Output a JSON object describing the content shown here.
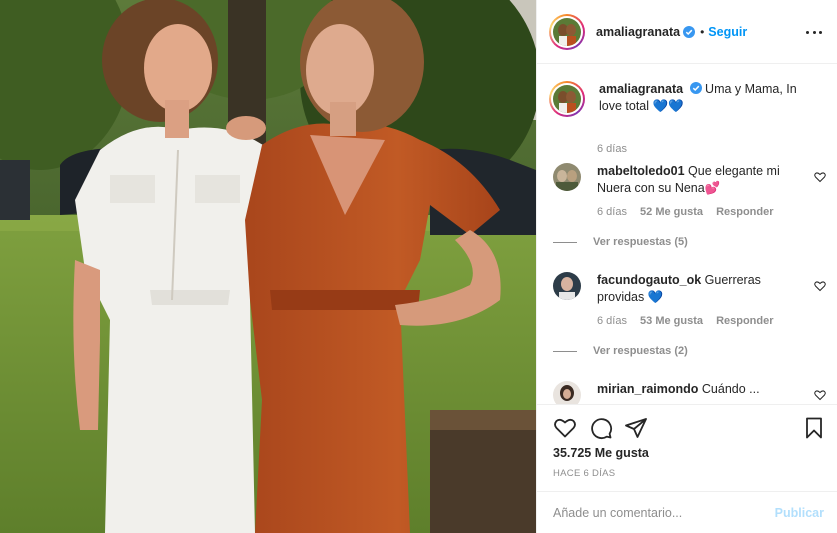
{
  "post": {
    "author": "amaliagranata",
    "follow_label": "Seguir",
    "dot": "•",
    "caption": {
      "text": "Uma y Mama, In love total 💙💙",
      "ago": "6 días"
    },
    "comments": [
      {
        "user": "mabeltoledo01",
        "text": "Que elegante mi Nuera con su Nena💕",
        "ago": "6 días",
        "likes": "52 Me gusta",
        "reply": "Responder",
        "replies": "Ver respuestas (5)"
      },
      {
        "user": "facundogauto_ok",
        "text": "Guerreras providas 💙",
        "ago": "6 días",
        "likes": "53 Me gusta",
        "reply": "Responder",
        "replies": "Ver respuestas (2)"
      },
      {
        "user": "mirian_raimondo",
        "text": "Cuándo ...",
        "ago": "",
        "likes": "",
        "reply": "",
        "replies": ""
      }
    ],
    "like_count": "35.725 Me gusta",
    "posted_ago": "HACE 6 DÍAS",
    "add_comment_placeholder": "Añade un comentario...",
    "publish_label": "Publicar"
  },
  "icons": [
    "verified-badge-icon",
    "more-options-icon",
    "heart-icon",
    "comment-icon",
    "share-icon",
    "bookmark-icon"
  ],
  "colors": {
    "link_blue": "#0095f6",
    "publish_disabled": "#b2dffc",
    "muted_text": "#8e8e8e",
    "border": "#efefef"
  }
}
